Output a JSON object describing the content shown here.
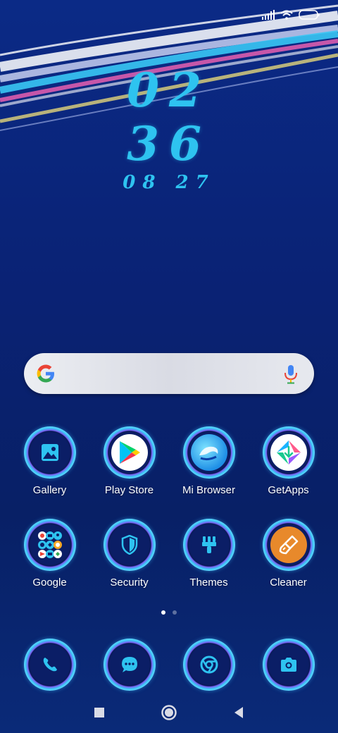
{
  "clock": {
    "hour": "02",
    "minute": "36",
    "date": "08 27"
  },
  "search": {
    "engine_icon": "google-g-icon",
    "mic_icon": "microphone-icon"
  },
  "apps_row1": [
    {
      "label": "Gallery",
      "icon": "gallery-icon"
    },
    {
      "label": "Play Store",
      "icon": "play-store-icon"
    },
    {
      "label": "Mi Browser",
      "icon": "mi-browser-icon"
    },
    {
      "label": "GetApps",
      "icon": "getapps-icon"
    }
  ],
  "apps_row2": [
    {
      "label": "Google",
      "icon": "google-folder-icon"
    },
    {
      "label": "Security",
      "icon": "security-shield-icon"
    },
    {
      "label": "Themes",
      "icon": "themes-brush-icon"
    },
    {
      "label": "Cleaner",
      "icon": "cleaner-broom-icon"
    }
  ],
  "dock": [
    {
      "icon": "phone-icon"
    },
    {
      "icon": "messaging-icon"
    },
    {
      "icon": "chrome-icon"
    },
    {
      "icon": "camera-icon"
    }
  ],
  "page_indicator": {
    "pages": 2,
    "active": 1
  },
  "colors": {
    "accent": "#2ec3f0",
    "background": "#0a2274",
    "ring": "#3ec8f7"
  }
}
